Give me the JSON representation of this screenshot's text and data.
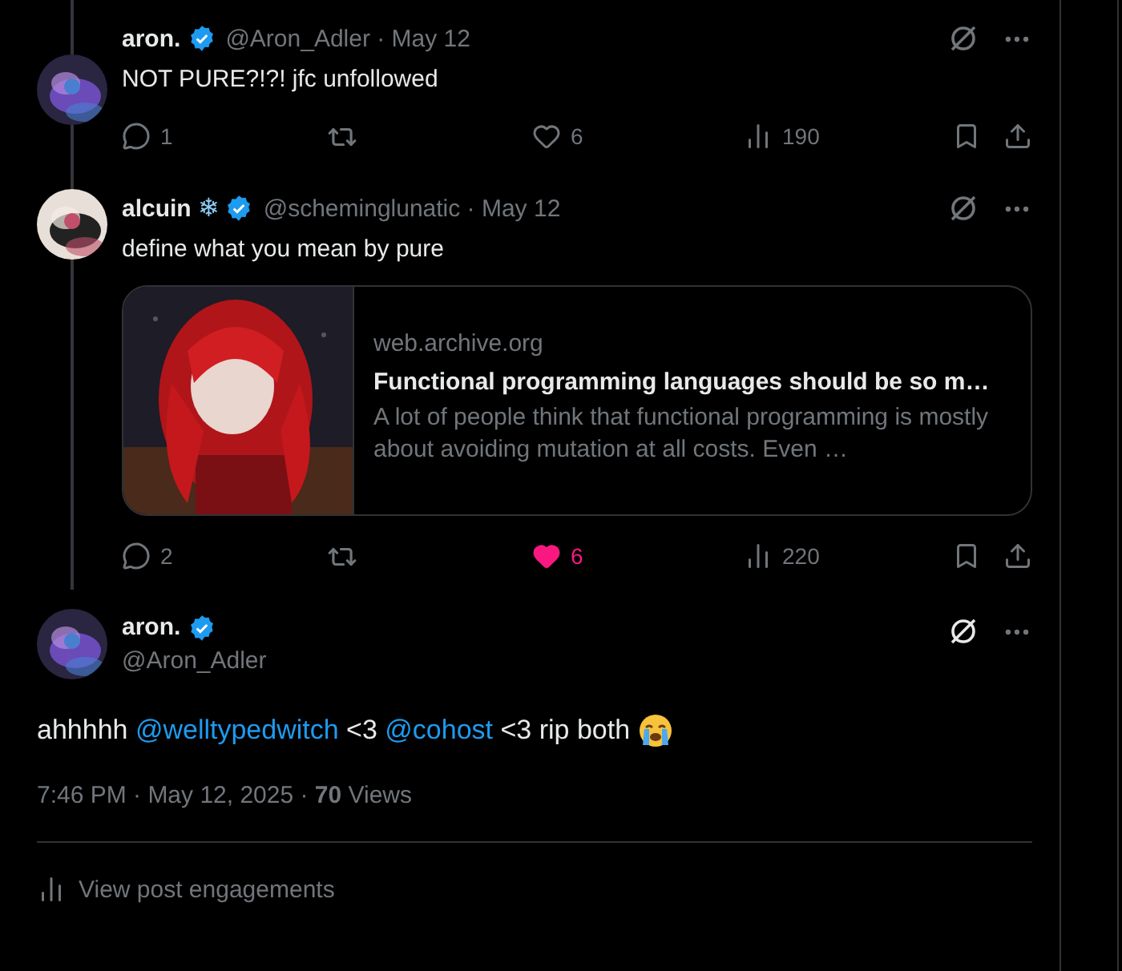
{
  "replies": [
    {
      "name": "aron.",
      "verified": true,
      "handle_line": "@Aron_Adler · May 12",
      "text": "NOT PURE?!?! jfc unfollowed",
      "actions": [
        {
          "kind": "reply",
          "count": "1"
        },
        {
          "kind": "repost"
        },
        {
          "kind": "like",
          "count": "6",
          "liked": false
        },
        {
          "kind": "views",
          "count": "190"
        },
        {
          "kind": "bookmark"
        },
        {
          "kind": "share"
        }
      ]
    },
    {
      "name": "alcuin",
      "name_emoji": "❄",
      "verified": true,
      "handle_line": "@scheminglunatic · May 12",
      "text": "define what you mean by pure",
      "card": {
        "domain": "web.archive.org",
        "title": "Functional programming languages should be so m…",
        "description": "A lot of people think that functional programming is mostly about avoiding mutation at all costs. Even …"
      },
      "actions": [
        {
          "kind": "reply",
          "count": "2"
        },
        {
          "kind": "repost"
        },
        {
          "kind": "like",
          "count": "6",
          "liked": true
        },
        {
          "kind": "views",
          "count": "220"
        },
        {
          "kind": "bookmark"
        },
        {
          "kind": "share"
        }
      ]
    }
  ],
  "main_post": {
    "name": "aron.",
    "verified": true,
    "handle": "@Aron_Adler",
    "segments": [
      {
        "kind": "text",
        "text": "ahhhhh "
      },
      {
        "kind": "mention",
        "text": "@welltypedwitch"
      },
      {
        "kind": "text",
        "text": " <3 "
      },
      {
        "kind": "mention",
        "text": "@cohost"
      },
      {
        "kind": "text",
        "text": " <3 rip both "
      },
      {
        "kind": "emoji"
      }
    ],
    "meta": "7:46 PM · May 12, 2025 · **70** Views",
    "engagements": "View post engagements"
  }
}
